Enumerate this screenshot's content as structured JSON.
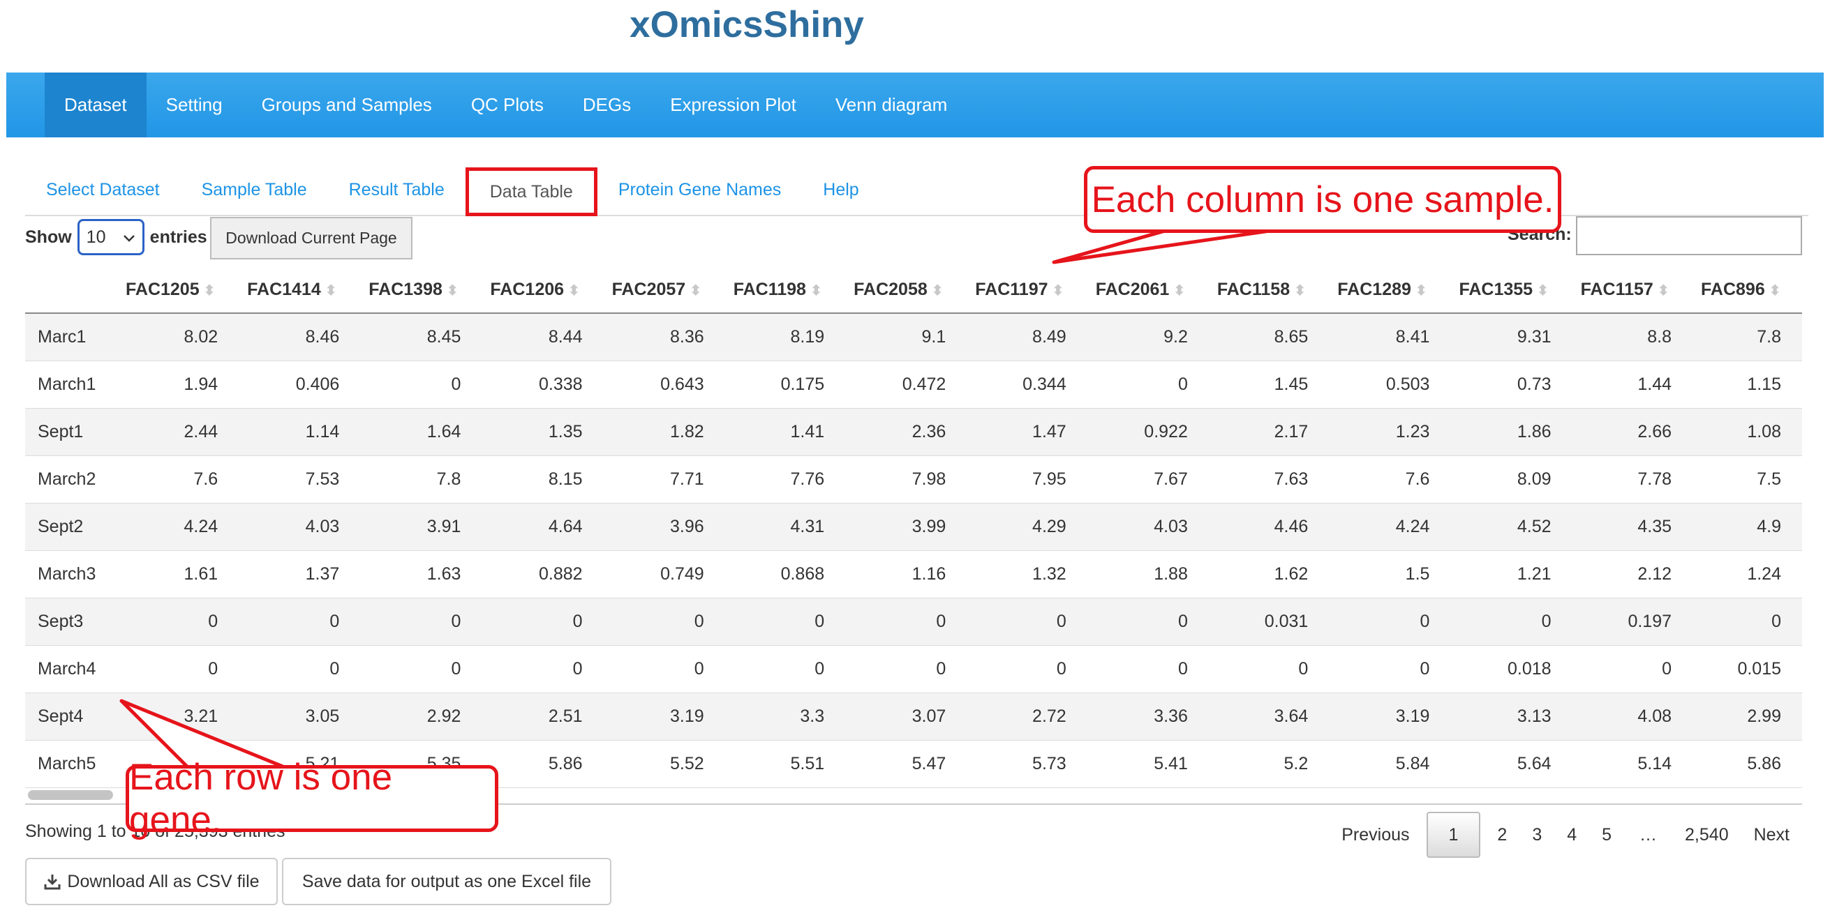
{
  "app": {
    "title": "xOmicsShiny"
  },
  "navbar": {
    "items": [
      {
        "label": "Dataset",
        "active": true
      },
      {
        "label": "Setting"
      },
      {
        "label": "Groups and Samples"
      },
      {
        "label": "QC Plots"
      },
      {
        "label": "DEGs"
      },
      {
        "label": "Expression Plot"
      },
      {
        "label": "Venn diagram"
      }
    ]
  },
  "tabs": [
    {
      "label": "Select Dataset"
    },
    {
      "label": "Sample Table"
    },
    {
      "label": "Result Table"
    },
    {
      "label": "Data Table",
      "active": true
    },
    {
      "label": "Protein Gene Names"
    },
    {
      "label": "Help"
    }
  ],
  "controls": {
    "show_label": "Show",
    "entries_value": "10",
    "entries_label": "entries",
    "download_page_label": "Download Current Page",
    "search_label": "Search:",
    "search_value": ""
  },
  "table": {
    "columns": [
      "FAC1205",
      "FAC1414",
      "FAC1398",
      "FAC1206",
      "FAC2057",
      "FAC1198",
      "FAC2058",
      "FAC1197",
      "FAC2061",
      "FAC1158",
      "FAC1289",
      "FAC1355",
      "FAC1157",
      "FAC896"
    ],
    "rows": [
      {
        "name": "Marc1",
        "values": [
          "8.02",
          "8.46",
          "8.45",
          "8.44",
          "8.36",
          "8.19",
          "9.1",
          "8.49",
          "9.2",
          "8.65",
          "8.41",
          "9.31",
          "8.8",
          "7.8"
        ]
      },
      {
        "name": "March1",
        "values": [
          "1.94",
          "0.406",
          "0",
          "0.338",
          "0.643",
          "0.175",
          "0.472",
          "0.344",
          "0",
          "1.45",
          "0.503",
          "0.73",
          "1.44",
          "1.15"
        ]
      },
      {
        "name": "Sept1",
        "values": [
          "2.44",
          "1.14",
          "1.64",
          "1.35",
          "1.82",
          "1.41",
          "2.36",
          "1.47",
          "0.922",
          "2.17",
          "1.23",
          "1.86",
          "2.66",
          "1.08"
        ]
      },
      {
        "name": "March2",
        "values": [
          "7.6",
          "7.53",
          "7.8",
          "8.15",
          "7.71",
          "7.76",
          "7.98",
          "7.95",
          "7.67",
          "7.63",
          "7.6",
          "8.09",
          "7.78",
          "7.5"
        ]
      },
      {
        "name": "Sept2",
        "values": [
          "4.24",
          "4.03",
          "3.91",
          "4.64",
          "3.96",
          "4.31",
          "3.99",
          "4.29",
          "4.03",
          "4.46",
          "4.24",
          "4.52",
          "4.35",
          "4.9"
        ]
      },
      {
        "name": "March3",
        "values": [
          "1.61",
          "1.37",
          "1.63",
          "0.882",
          "0.749",
          "0.868",
          "1.16",
          "1.32",
          "1.88",
          "1.62",
          "1.5",
          "1.21",
          "2.12",
          "1.24"
        ]
      },
      {
        "name": "Sept3",
        "values": [
          "0",
          "0",
          "0",
          "0",
          "0",
          "0",
          "0",
          "0",
          "0",
          "0.031",
          "0",
          "0",
          "0.197",
          "0"
        ]
      },
      {
        "name": "March4",
        "values": [
          "0",
          "0",
          "0",
          "0",
          "0",
          "0",
          "0",
          "0",
          "0",
          "0",
          "0",
          "0.018",
          "0",
          "0.015"
        ]
      },
      {
        "name": "Sept4",
        "values": [
          "3.21",
          "3.05",
          "2.92",
          "2.51",
          "3.19",
          "3.3",
          "3.07",
          "2.72",
          "3.36",
          "3.64",
          "3.19",
          "3.13",
          "4.08",
          "2.99"
        ]
      },
      {
        "name": "March5",
        "values": [
          "",
          "5.21",
          "5.35",
          "5.86",
          "5.52",
          "5.51",
          "5.47",
          "5.73",
          "5.41",
          "5.2",
          "5.84",
          "5.64",
          "5.14",
          "5.86"
        ]
      }
    ]
  },
  "footer": {
    "info": "Showing 1 to 10 of 25,393 entries",
    "pagination": {
      "previous": "Previous",
      "pages": [
        "1",
        "2",
        "3",
        "4",
        "5",
        "…",
        "2,540"
      ],
      "current": "1",
      "next": "Next"
    },
    "buttons": {
      "download_csv": "Download All as CSV file",
      "save_excel": "Save data for output as one Excel file"
    }
  },
  "annotations": {
    "column_note": "Each column is one sample.",
    "row_note": "Each row is one gene.",
    "color": "#e6141b"
  },
  "colors": {
    "navbar": "#2196e6",
    "navbar_active": "#1d84cf",
    "link": "#1d93e6",
    "title": "#2e6e9e"
  }
}
